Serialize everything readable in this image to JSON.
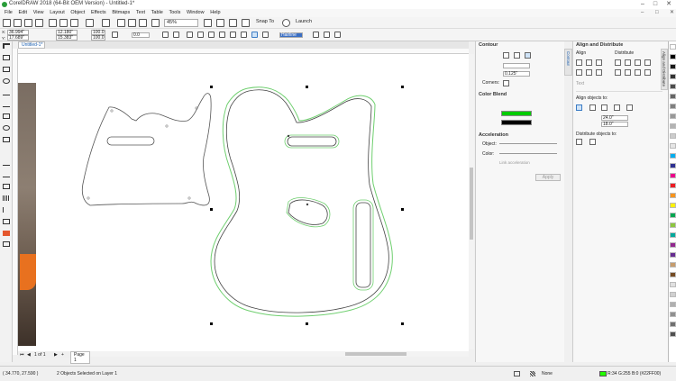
{
  "window": {
    "title": "CorelDRAW 2018 (64-Bit OEM Version) - Untitled-1*",
    "minimize": "–",
    "maximize": "□",
    "close": "✕"
  },
  "menu": {
    "items": [
      "File",
      "Edit",
      "View",
      "Layout",
      "Object",
      "Effects",
      "Bitmaps",
      "Text",
      "Table",
      "Tools",
      "Window",
      "Help"
    ]
  },
  "toolbar": {
    "zoom": "45%",
    "snap_to": "Snap To",
    "launch": "Launch"
  },
  "property_bar": {
    "x": "36.994\"",
    "y": "17.689\"",
    "width": "12.180\"",
    "height": "15.383\"",
    "scale_x": "100.0",
    "scale_y": "100.0",
    "angle": "0.0",
    "outline_width": "0.0",
    "outline_style": "Hairline"
  },
  "document": {
    "tab_label": "Untitled-1*",
    "page_indicator": "1 of 1",
    "page_tab": "Page 1"
  },
  "contour_panel": {
    "title": "Contour",
    "offset": "0.125\"",
    "corners_label": "Corners:",
    "color_blend_label": "Color Blend",
    "acceleration_label": "Acceleration",
    "object_label": "Object:",
    "color_label": "Color:",
    "link_acceleration": "Link acceleration",
    "apply": "Apply",
    "outline_color": "#00cc00",
    "fill_color": "#000000"
  },
  "align_panel": {
    "title": "Align and Distribute",
    "align_label": "Align",
    "distribute_label": "Distribute",
    "text_label": "Text",
    "align_objects_to": "Align objects to:",
    "x_value": "24.0\"",
    "y_value": "18.0\"",
    "distribute_objects_to": "Distribute objects to:"
  },
  "side_tabs": {
    "contour": "Contour",
    "align": "Align and Distribute"
  },
  "status": {
    "coordinates": "( 34.770, 27.590 )",
    "selection": "2 Objects Selected on Layer 1",
    "fill_none": "None",
    "color_readout": "R:34 G:255 B:0 (#22FF00)"
  },
  "palette": [
    "#ffffff",
    "#000000",
    "#1a1a1a",
    "#333333",
    "#4d4d4d",
    "#666666",
    "#808080",
    "#999999",
    "#b3b3b3",
    "#cccccc",
    "#e6e6e6",
    "#00aeef",
    "#2e3192",
    "#ec008c",
    "#ed1c24",
    "#f7941d",
    "#fff200",
    "#00a651",
    "#8dc63f",
    "#00a99d",
    "#92278f",
    "#662d91",
    "#c69c6d",
    "#754c24",
    "#e0e0e0",
    "#d0d0d0",
    "#b0b0b0",
    "#909090",
    "#707070",
    "#505050"
  ]
}
